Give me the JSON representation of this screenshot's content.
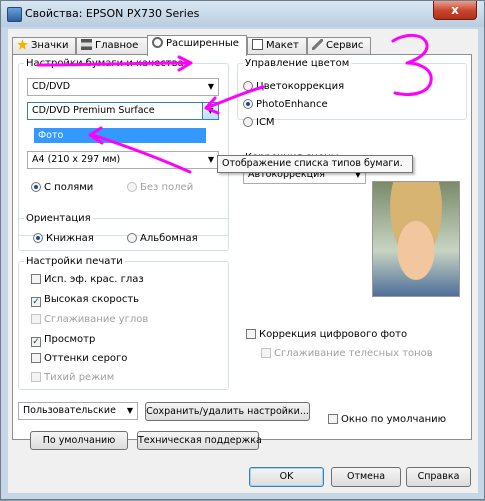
{
  "window": {
    "title": "Свойства: EPSON PX730 Series",
    "close": "x"
  },
  "tabs": [
    {
      "label": "Значки"
    },
    {
      "label": "Главное"
    },
    {
      "label": "Расширенные"
    },
    {
      "label": "Макет"
    },
    {
      "label": "Сервис"
    }
  ],
  "paper": {
    "legend": "Настройки бумаги и качества",
    "source": "CD/DVD",
    "type": "CD/DVD Premium Surface",
    "quality": "Фото",
    "size": "A4 (210 x 297 мм)",
    "border_on": "С полями",
    "border_off": "Без полей"
  },
  "tooltip": "Отображение списка типов бумаги.",
  "orientation": {
    "legend": "Ориентация",
    "portrait": "Книжная",
    "landscape": "Альбомная"
  },
  "print_settings": {
    "legend": "Настройки печати",
    "items": [
      {
        "label": "Исп. эф. крас. глаз",
        "checked": false,
        "enabled": true
      },
      {
        "label": "Высокая скорость",
        "checked": true,
        "enabled": true
      },
      {
        "label": "Сглаживание углов",
        "checked": false,
        "enabled": false
      },
      {
        "label": "Просмотр",
        "checked": true,
        "enabled": true
      },
      {
        "label": "Оттенки серого",
        "checked": false,
        "enabled": true
      },
      {
        "label": "Тихий режим",
        "checked": false,
        "enabled": false
      }
    ]
  },
  "color": {
    "legend": "Управление цветом",
    "opt1": "Цветокоррекция",
    "opt2": "PhotoEnhance",
    "opt3": "ICM",
    "scene_label": "Коррекция сцены",
    "scene_value": "Автокоррекция",
    "digital": "Коррекция цифрового фото",
    "skin": "Сглаживание телесных тонов"
  },
  "bottom": {
    "preset": "Пользовательские",
    "save": "Сохранить/удалить настройки...",
    "show_default": "Окно по умолчанию",
    "defaults": "По умолчанию",
    "support": "Техническая поддержка"
  },
  "dialog": {
    "ok": "OK",
    "cancel": "Отмена",
    "help": "Справка"
  },
  "annotation": {
    "number": "3",
    "color": "#ff00ff"
  }
}
